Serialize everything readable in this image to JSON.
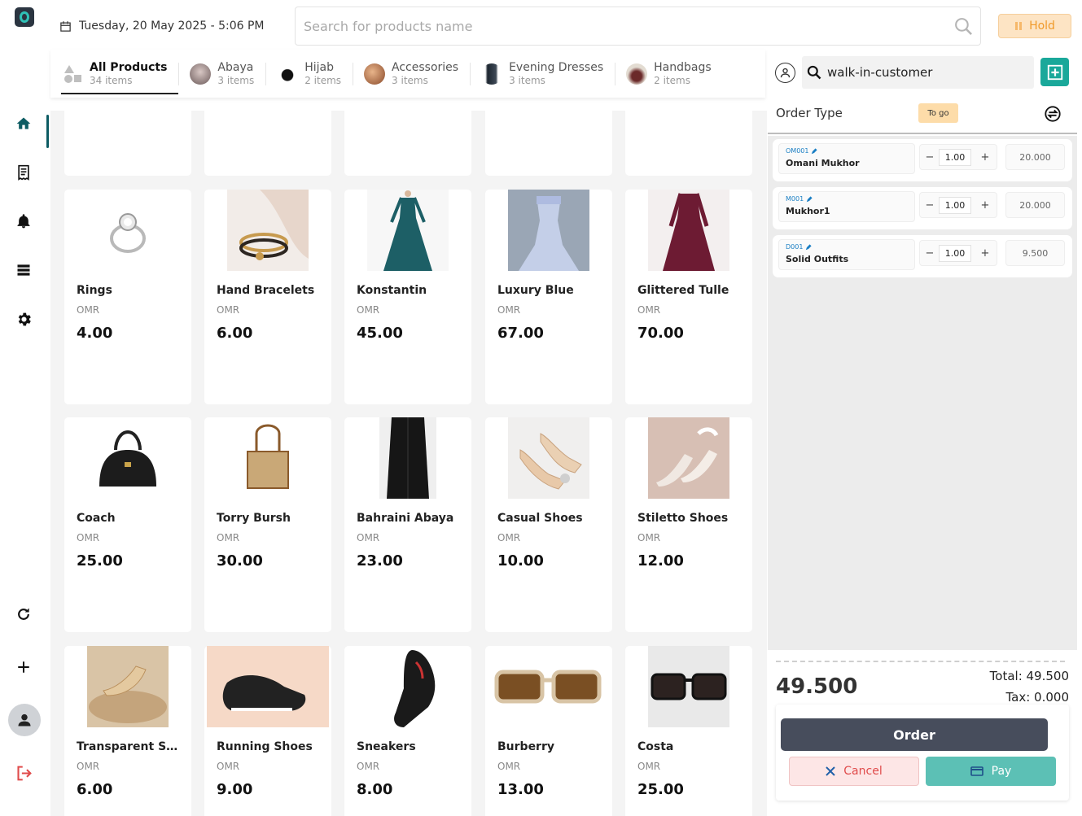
{
  "header": {
    "datetime": "Tuesday, 20 May 2025 - 5:06 PM",
    "search_placeholder": "Search for products name",
    "hold_label": "Hold"
  },
  "colors": {
    "accent": "#1aa89a",
    "active_nav": "#0d5c63",
    "hold": "#f09a2a",
    "cancel": "#e04b4b",
    "pay": "#5cc0b5",
    "order_btn": "#474d5c"
  },
  "sidebar": {
    "top_items": [
      {
        "name": "home-icon",
        "active": true
      },
      {
        "name": "receipt-icon"
      },
      {
        "name": "bell-icon"
      },
      {
        "name": "list-icon"
      },
      {
        "name": "gear-icon"
      }
    ],
    "bottom_items": [
      {
        "name": "refresh-icon"
      },
      {
        "name": "plus-icon"
      },
      {
        "name": "user-avatar-icon"
      },
      {
        "name": "logout-icon"
      }
    ]
  },
  "categories": [
    {
      "label": "All Products",
      "count": "34 items",
      "active": true
    },
    {
      "label": "Abaya",
      "count": "3 items"
    },
    {
      "label": "Hijab",
      "count": "2 items"
    },
    {
      "label": "Accessories",
      "count": "3 items"
    },
    {
      "label": "Evening Dresses",
      "count": "3 items"
    },
    {
      "label": "Handbags",
      "count": "2 items"
    }
  ],
  "products": [
    {
      "name": "Rings",
      "currency": "OMR",
      "price": "4.00",
      "icon": "ring-icon"
    },
    {
      "name": "Hand Bracelets",
      "currency": "OMR",
      "price": "6.00",
      "icon": "bracelet-icon"
    },
    {
      "name": "Konstantin",
      "currency": "OMR",
      "price": "45.00",
      "icon": "dress-icon"
    },
    {
      "name": "Luxury Blue",
      "currency": "OMR",
      "price": "67.00",
      "icon": "dress-icon"
    },
    {
      "name": "Glittered Tulle",
      "currency": "OMR",
      "price": "70.00",
      "icon": "dress-icon"
    },
    {
      "name": "Coach",
      "currency": "OMR",
      "price": "25.00",
      "icon": "handbag-icon"
    },
    {
      "name": "Torry Bursh",
      "currency": "OMR",
      "price": "30.00",
      "icon": "handbag-icon"
    },
    {
      "name": "Bahraini Abaya",
      "currency": "OMR",
      "price": "23.00",
      "icon": "abaya-icon"
    },
    {
      "name": "Casual Shoes",
      "currency": "OMR",
      "price": "10.00",
      "icon": "shoe-icon"
    },
    {
      "name": "Stiletto Shoes",
      "currency": "OMR",
      "price": "12.00",
      "icon": "shoe-icon"
    },
    {
      "name": "Transparent Shoes",
      "currency": "OMR",
      "price": "6.00",
      "icon": "shoe-icon"
    },
    {
      "name": "Running Shoes",
      "currency": "OMR",
      "price": "9.00",
      "icon": "sneaker-icon"
    },
    {
      "name": "Sneakers",
      "currency": "OMR",
      "price": "8.00",
      "icon": "sneaker-icon"
    },
    {
      "name": "Burberry",
      "currency": "OMR",
      "price": "13.00",
      "icon": "sunglasses-icon"
    },
    {
      "name": "Costa",
      "currency": "OMR",
      "price": "25.00",
      "icon": "sunglasses-icon"
    }
  ],
  "customer": {
    "value": "walk-in-customer"
  },
  "order_type": {
    "label": "Order Type",
    "value": "To go"
  },
  "order_lines": [
    {
      "code": "OM001",
      "name": "Omani Mukhor",
      "qty": "1.00",
      "price": "20.000"
    },
    {
      "code": "M001",
      "name": "Mukhor1",
      "qty": "1.00",
      "price": "20.000"
    },
    {
      "code": "D001",
      "name": "Solid Outfits",
      "qty": "1.00",
      "price": "9.500"
    }
  ],
  "summary": {
    "grand_total": "49.500",
    "total_text": "Total: 49.500",
    "tax_text": "Tax: 0.000"
  },
  "actions": {
    "order_label": "Order",
    "cancel_label": "Cancel",
    "pay_label": "Pay"
  }
}
